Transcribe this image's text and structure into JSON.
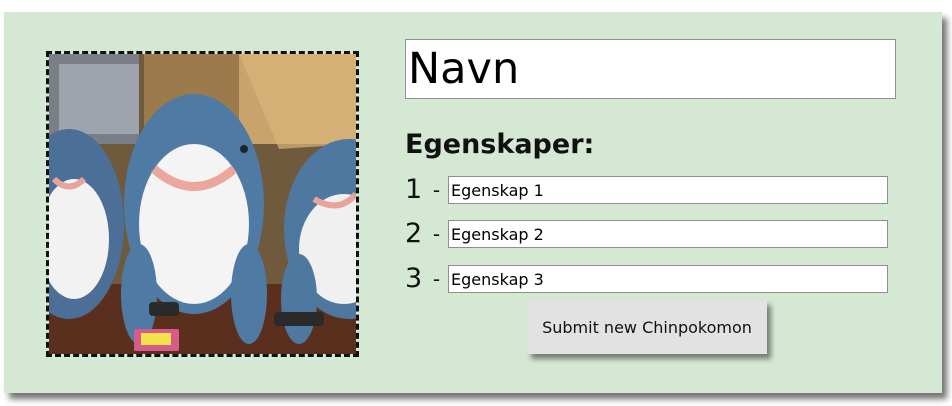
{
  "form": {
    "name_placeholder": "Navn",
    "properties_heading": "Egenskaper:",
    "properties": [
      {
        "number": "1",
        "separator": "-",
        "placeholder": "Egenskap 1"
      },
      {
        "number": "2",
        "separator": "-",
        "placeholder": "Egenskap 2"
      },
      {
        "number": "3",
        "separator": "-",
        "placeholder": "Egenskap 3"
      }
    ],
    "submit_label": "Submit new Chinpokomon"
  },
  "image": {
    "icon": "photo-plush-sharks"
  },
  "colors": {
    "card_background": "#d4e8d4",
    "button_background": "#e2e2e2"
  }
}
